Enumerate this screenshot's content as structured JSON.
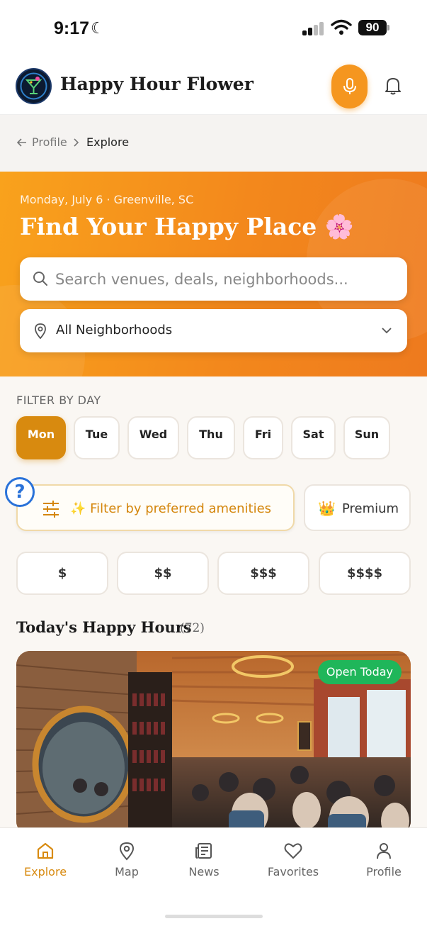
{
  "status_bar": {
    "time": "9:17",
    "battery": "90"
  },
  "header": {
    "app_title": "Happy Hour Flower"
  },
  "breadcrumb": {
    "parent": "Profile",
    "current": "Explore"
  },
  "hero": {
    "date_location": "Monday, July 6 · Greenville, SC",
    "title": "Find Your Happy Place 🌸",
    "search_placeholder": "Search venues, deals, neighborhoods...",
    "neighborhood_selected": "All Neighborhoods"
  },
  "filters": {
    "day_label": "FILTER BY DAY",
    "days": [
      "Mon",
      "Tue",
      "Wed",
      "Thu",
      "Fri",
      "Sat",
      "Sun"
    ],
    "selected_day": "Mon",
    "amenities_label": "✨ Filter by preferred amenities",
    "premium_label": "Premium",
    "prices": [
      "$",
      "$$",
      "$$$",
      "$$$$"
    ],
    "help_label": "?"
  },
  "section": {
    "title": "Today's Happy Hours",
    "count": "(72)"
  },
  "card": {
    "badge": "Open Today"
  },
  "nav": {
    "items": [
      {
        "label": "Explore",
        "icon": "home-icon"
      },
      {
        "label": "Map",
        "icon": "map-pin-icon"
      },
      {
        "label": "News",
        "icon": "newspaper-icon"
      },
      {
        "label": "Favorites",
        "icon": "heart-icon"
      },
      {
        "label": "Profile",
        "icon": "user-icon"
      }
    ],
    "active": "Explore"
  },
  "colors": {
    "accent": "#d88a0f",
    "hero_orange": "#f3881c",
    "mic_orange": "#f5961f",
    "open_green": "#1fb65a"
  }
}
